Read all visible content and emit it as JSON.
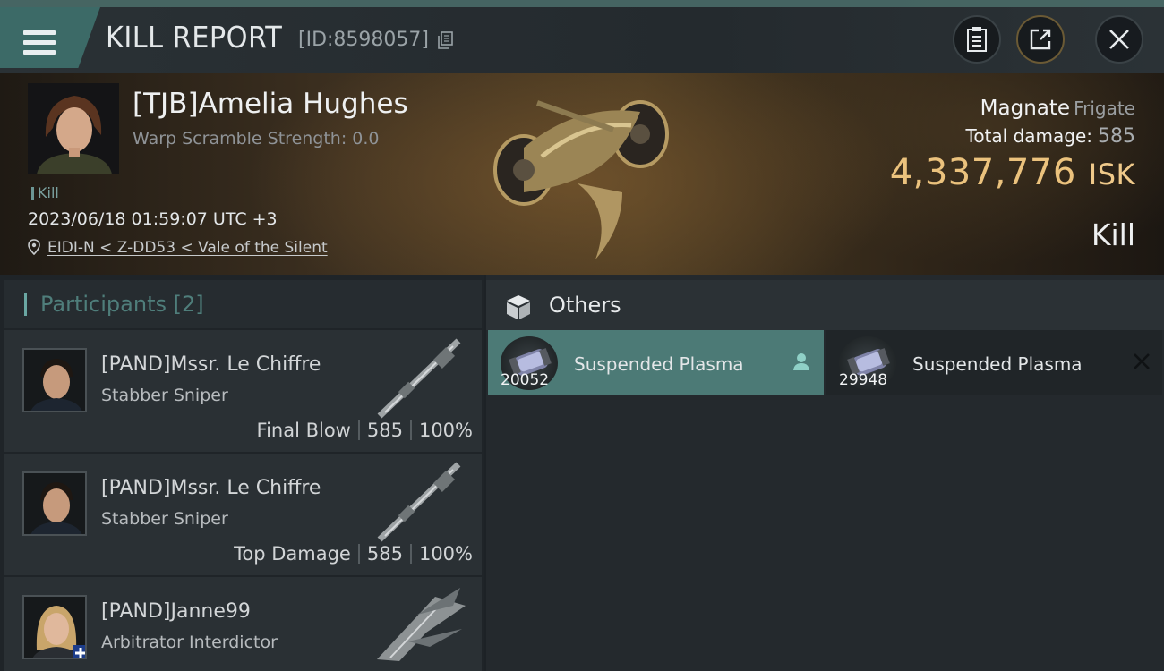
{
  "header": {
    "title": "KILL REPORT",
    "report_id": "[ID:8598057]",
    "icons": [
      "menu-icon",
      "copy-icon",
      "clipboard-icon",
      "share-icon",
      "close-icon"
    ]
  },
  "victim": {
    "name": "[TJB]Amelia Hughes",
    "warp_scramble": "Warp Scramble Strength: 0.0",
    "tag": "Kill",
    "datetime": "2023/06/18 01:59:07 UTC +3",
    "location": "EIDI-N < Z-DD53 < Vale of the Silent",
    "ship_name": "Magnate",
    "ship_class": "Frigate",
    "total_damage_label": "Total damage:",
    "total_damage_value": "585",
    "isk_value": "4,337,776",
    "isk_label": "ISK",
    "result": "Kill"
  },
  "participants": {
    "title": "Participants",
    "count": "[2]",
    "rows": [
      {
        "name": "[PAND]Mssr. Le Chiffre",
        "ship": "Stabber Sniper",
        "role": "Final Blow",
        "damage": "585",
        "percent": "100%"
      },
      {
        "name": "[PAND]Mssr. Le Chiffre",
        "ship": "Stabber Sniper",
        "role": "Top Damage",
        "damage": "585",
        "percent": "100%"
      },
      {
        "name": "[PAND]Janne99",
        "ship": "Arbitrator Interdictor"
      }
    ]
  },
  "others": {
    "title": "Others",
    "items": [
      {
        "name": "Suspended Plasma",
        "qty": "20052",
        "status": "user-icon",
        "highlight_color": "#4c7a76"
      },
      {
        "name": "Suspended Plasma",
        "qty": "29948",
        "status": "close-x-icon"
      }
    ]
  },
  "colors": {
    "accent": "#4c7a76",
    "isk": "#ebc27d"
  }
}
